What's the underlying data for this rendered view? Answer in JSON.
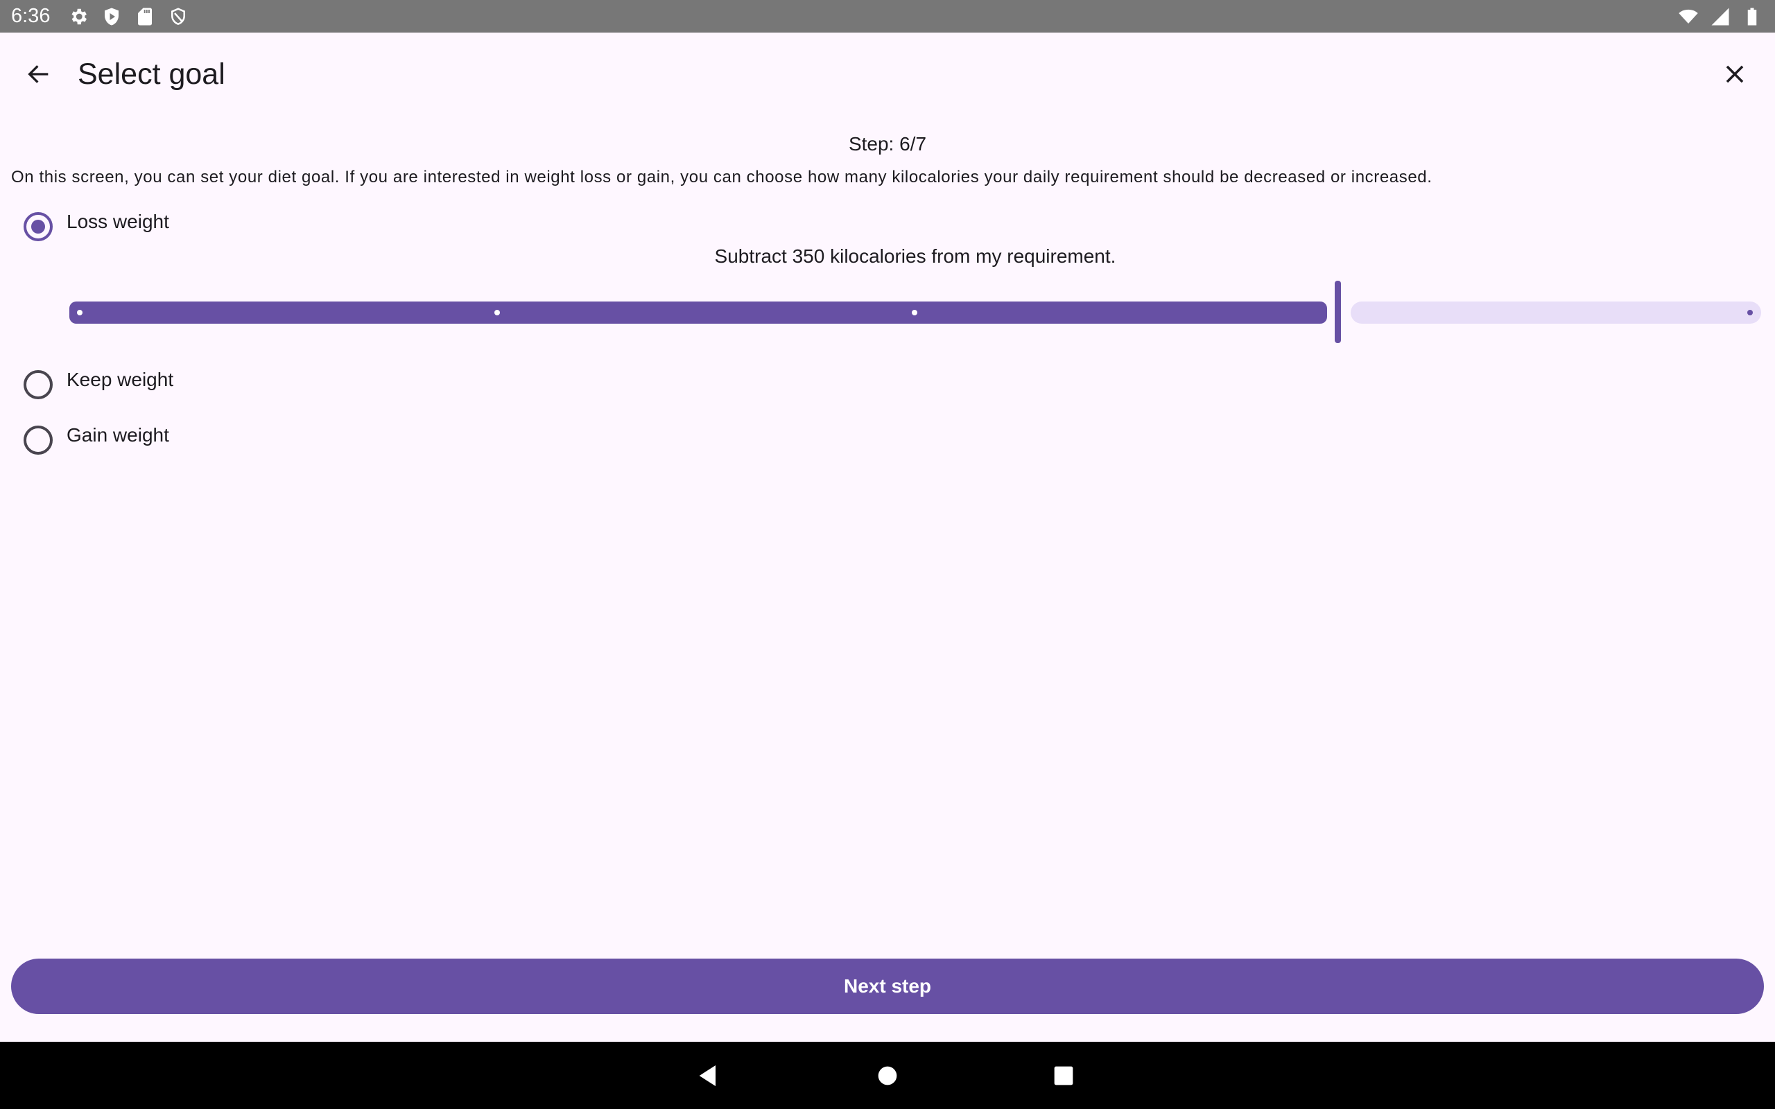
{
  "status_bar": {
    "time": "6:36",
    "left_icons": [
      "settings-icon",
      "play-protect-icon",
      "sd-card-icon",
      "shield-icon"
    ],
    "right_icons": [
      "wifi-icon",
      "cell-signal-icon",
      "battery-icon"
    ]
  },
  "app_bar": {
    "title": "Select goal",
    "back_icon": "arrow-back-icon",
    "close_icon": "close-icon"
  },
  "content": {
    "step": "Step: 6/7",
    "intro": "On this screen, you can set your diet goal. If you are interested in weight loss or gain, you can choose how many kilocalories your daily requirement should be decreased or increased.",
    "options": [
      {
        "label": "Loss weight",
        "selected": true
      },
      {
        "label": "Keep weight",
        "selected": false
      },
      {
        "label": "Gain weight",
        "selected": false
      }
    ],
    "slider_caption": "Subtract 350 kilocalories from my requirement.",
    "slider": {
      "steps": 4,
      "value_fraction": 0.75,
      "active_color": "#6750a4",
      "inactive_color": "#e8def8"
    }
  },
  "footer": {
    "next_label": "Next step"
  },
  "nav_bar": {
    "icons": [
      "back-triangle-icon",
      "home-circle-icon",
      "recents-square-icon"
    ]
  },
  "colors": {
    "primary": "#6750a4",
    "background": "#fef7ff",
    "status_bar": "#777777"
  }
}
